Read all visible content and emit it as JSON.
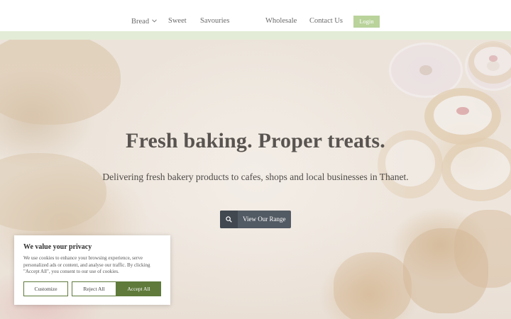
{
  "nav": {
    "items": [
      {
        "label": "Bread",
        "has_dropdown": true
      },
      {
        "label": "Sweet",
        "has_dropdown": false
      },
      {
        "label": "Savouries",
        "has_dropdown": false
      },
      {
        "label": "Wholesale",
        "has_dropdown": false
      },
      {
        "label": "Contact Us",
        "has_dropdown": false
      }
    ],
    "dropdown_icon": "chevron-down-icon",
    "login_label": "Login"
  },
  "hero": {
    "title": "Fresh baking. Proper treats.",
    "subtitle": "Delivering fresh bakery products to cafes, shops and local businesses in Thanet.",
    "cta_label": "View Our Range",
    "cta_icon": "search-icon"
  },
  "cookie_banner": {
    "title": "We value your privacy",
    "text": "We use cookies to enhance your browsing experience, serve personalized ads or content, and analyse our traffic. By clicking \"Accept All\", you consent to our use of cookies.",
    "customize_label": "Customize",
    "reject_label": "Reject All",
    "accept_label": "Accept All"
  },
  "colors": {
    "accent_green": "#5f7a3b",
    "login_green": "#b9d39b",
    "header_band": "#e3ecd6",
    "cta_button": "#525a63"
  }
}
